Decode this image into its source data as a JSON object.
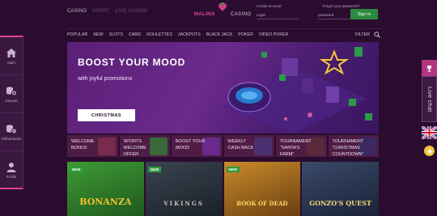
{
  "topnav": {
    "casino": "CASINO",
    "sport": "SPORT",
    "live_casino": "LIVE CASINO"
  },
  "logo": {
    "left": "MALINA",
    "right": "CASINO"
  },
  "login": {
    "create_account": "Create account",
    "forgot_password": "Forgot your password?",
    "login_placeholder": "Login",
    "password_placeholder": "password",
    "signin_label": "Sign in"
  },
  "sidebar": {
    "items": [
      {
        "label": "Main",
        "icon": "home-icon"
      },
      {
        "label": "Deposit",
        "icon": "deposit-coins-icon"
      },
      {
        "label": "Withdrawals",
        "icon": "withdraw-coins-icon"
      },
      {
        "label": "Profile",
        "icon": "user-icon"
      }
    ]
  },
  "categories": [
    "POPULAR",
    "NEW",
    "SLOTS",
    "CARD",
    "ROULETTES",
    "JACKPOTS",
    "BLACK JACK",
    "POKER",
    "VIDEO POKER"
  ],
  "filter_label": "FILTER",
  "hero": {
    "title": "BOOST YOUR MOOD",
    "subtitle": "with joyful promotions",
    "cta": "CHRISTMAS"
  },
  "promos": [
    {
      "text": "WELCOME BONUS",
      "color": "#7a2a4a"
    },
    {
      "text": "SPORTS WELCOME OFFER",
      "color": "#3a6a3a"
    },
    {
      "text": "BOOST YOUR MOOD",
      "color": "#6a2a8c"
    },
    {
      "text": "WEEKLY CASH BACK",
      "color": "#4a3070"
    },
    {
      "text": "TOURNAMENT \"SANTA'S FARM\"",
      "color": "#5a2a3a"
    },
    {
      "text": "TOURNAMENT \"CHRISTMAS COUNTDOWN\"",
      "color": "#3a2a60"
    }
  ],
  "games": [
    {
      "title": "BONANZA",
      "badge": "NEW",
      "color": "#2e7a2a"
    },
    {
      "title": "VIKINGS",
      "badge": "NEW",
      "color": "#28323c"
    },
    {
      "title": "BOOK OF DEAD",
      "badge": "NEW",
      "color": "#a36b1a"
    },
    {
      "title": "GONZO'S QUEST",
      "badge": "",
      "color": "#2a3a55"
    }
  ],
  "rightrail": {
    "chat_label": "Live chat",
    "flag": "uk-flag-icon"
  }
}
